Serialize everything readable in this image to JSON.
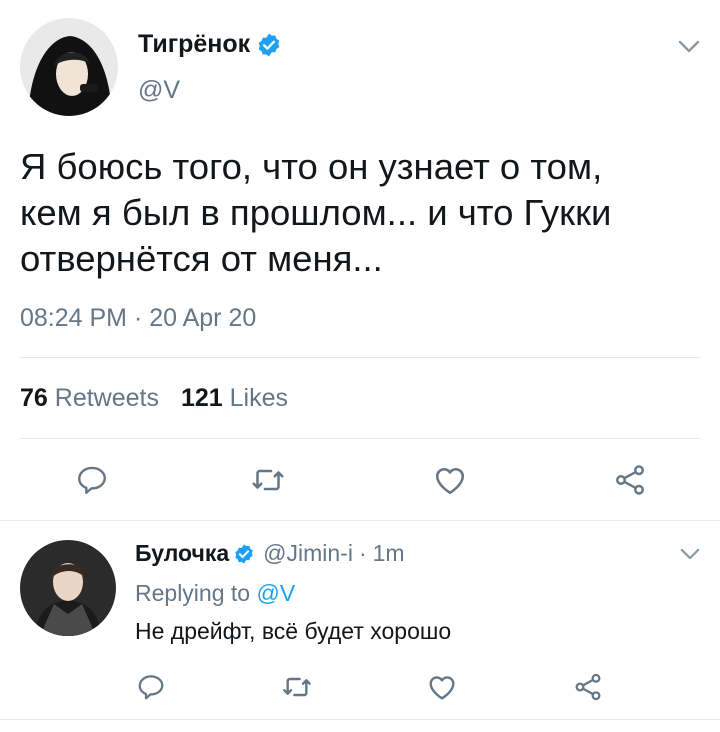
{
  "main_tweet": {
    "display_name": "Тигрёнок",
    "handle": "@V",
    "text_line1": "Я боюсь того, что он узнает о том,",
    "text_line2": "кем я был в прошлом... и что Гукки",
    "text_line3": "отвернётся от меня...",
    "timestamp": "08:24 PM · 20 Apr 20",
    "retweets_count": "76",
    "retweets_label": "Retweets",
    "likes_count": "121",
    "likes_label": "Likes"
  },
  "reply": {
    "display_name": "Булочка",
    "handle": "@Jimin-i",
    "separator": "·",
    "time": "1m",
    "replying_prefix": "Replying to",
    "replying_to": "@V",
    "text": "Не дрейфт, всё будет хорошо"
  },
  "icons": {
    "actions": [
      "reply-icon",
      "retweet-icon",
      "like-icon",
      "share-icon"
    ],
    "verified": "verified-badge-icon",
    "caret": "chevron-down-icon"
  },
  "colors": {
    "verified_blue": "#1da1f2",
    "secondary_text": "#657786",
    "primary_text": "#14171a",
    "divider": "#e1e8ed"
  }
}
